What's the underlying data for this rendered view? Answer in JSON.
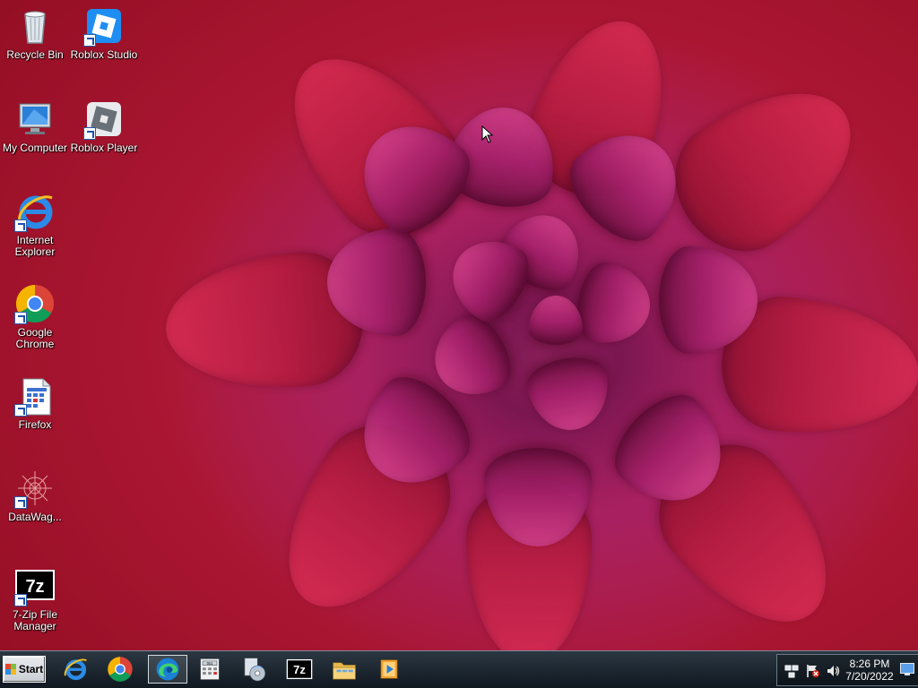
{
  "desktop": {
    "icons": [
      {
        "label": "Recycle Bin",
        "icon": "recycle-bin-icon"
      },
      {
        "label": "Roblox Studio",
        "icon": "roblox-studio-icon"
      },
      {
        "label": "My Computer",
        "icon": "my-computer-icon"
      },
      {
        "label": "Roblox Player",
        "icon": "roblox-player-icon"
      },
      {
        "label": "Internet Explorer",
        "icon": "internet-explorer-icon"
      },
      {
        "label": "Google Chrome",
        "icon": "google-chrome-icon"
      },
      {
        "label": "Firefox",
        "icon": "firefox-shortcut-icon"
      },
      {
        "label": "DataWag...",
        "icon": "datawag-icon"
      },
      {
        "label": "7-Zip File Manager",
        "icon": "seven-zip-icon"
      }
    ]
  },
  "taskbar": {
    "start_label": "Start",
    "pinned": [
      {
        "icon": "internet-explorer-icon"
      },
      {
        "icon": "google-chrome-icon"
      },
      {
        "icon": "edge-icon",
        "active": true
      },
      {
        "icon": "calculator-icon"
      },
      {
        "icon": "media-player-icon"
      },
      {
        "icon": "seven-zip-icon"
      },
      {
        "icon": "file-explorer-icon"
      },
      {
        "icon": "video-player-icon"
      }
    ],
    "tray": {
      "time": "8:26 PM",
      "date": "7/20/2022",
      "icons": [
        "network-icon",
        "action-center-flag-icon",
        "volume-icon"
      ]
    }
  },
  "colors": {
    "wallpaper_red": "#b0182f",
    "petal_magenta": "#b8246e",
    "taskbar": "#1a232c"
  }
}
